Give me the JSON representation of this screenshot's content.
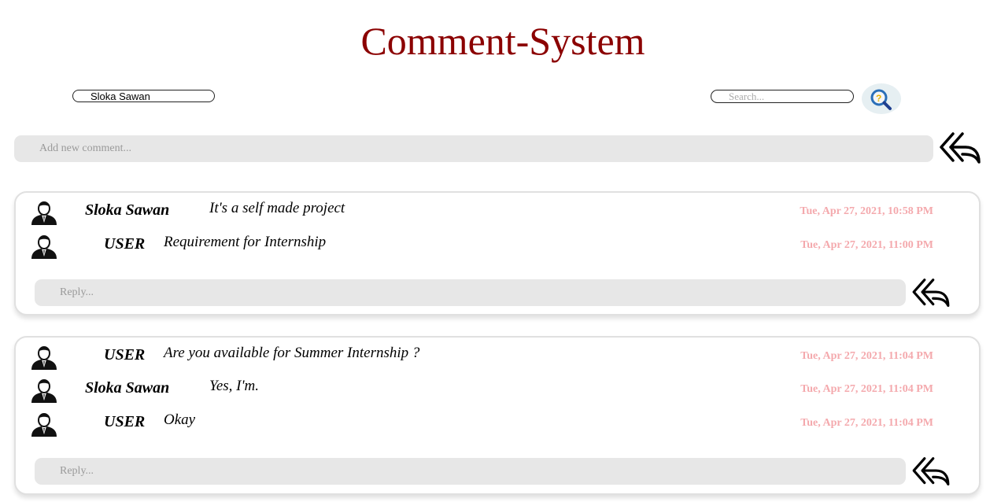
{
  "header": {
    "title": "Comment-System"
  },
  "user_field": {
    "value": "Sloka Sawan"
  },
  "search": {
    "placeholder": "Search...",
    "icon": "search-icon"
  },
  "new_comment": {
    "placeholder": "Add new comment...",
    "send_icon": "reply-arrow-icon"
  },
  "threads": [
    {
      "messages": [
        {
          "author": "Sloka Sawan",
          "text": "It's a self made project",
          "time": "Tue, Apr 27, 2021, 10:58 PM"
        },
        {
          "author": "USER",
          "text": "Requirement for Internship",
          "time": "Tue, Apr 27, 2021, 11:00 PM"
        }
      ],
      "reply_placeholder": "Reply..."
    },
    {
      "messages": [
        {
          "author": "USER",
          "text": "Are you available for Summer Internship ?",
          "time": "Tue, Apr 27, 2021, 11:04 PM"
        },
        {
          "author": "Sloka Sawan",
          "text": "Yes, I'm.",
          "time": "Tue, Apr 27, 2021, 11:04 PM"
        },
        {
          "author": "USER",
          "text": "Okay",
          "time": "Tue, Apr 27, 2021, 11:04 PM"
        }
      ],
      "reply_placeholder": "Reply..."
    }
  ],
  "colors": {
    "title": "#8b0000",
    "timestamp": "#f4a9ad",
    "input_bg": "#e7e7e7"
  }
}
